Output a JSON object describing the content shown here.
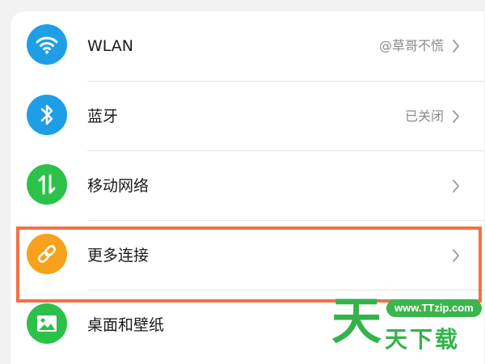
{
  "settings": {
    "items": [
      {
        "label": "WLAN",
        "value": "@草哥不慌",
        "icon": "wifi-icon",
        "color": "#1e9ee6"
      },
      {
        "label": "蓝牙",
        "value": "已关闭",
        "icon": "bluetooth-icon",
        "color": "#1e9ee6"
      },
      {
        "label": "移动网络",
        "value": "",
        "icon": "mobile-data-icon",
        "color": "#2bc14a"
      },
      {
        "label": "更多连接",
        "value": "",
        "icon": "link-icon",
        "color": "#f7a11c"
      },
      {
        "label": "桌面和壁纸",
        "value": "",
        "icon": "wallpaper-icon",
        "color": "#2bc14a"
      }
    ]
  },
  "highlight": {
    "color": "#f07247"
  },
  "watermark": {
    "big": "天",
    "url": "www.TTzip.com",
    "sub": "天下载"
  }
}
